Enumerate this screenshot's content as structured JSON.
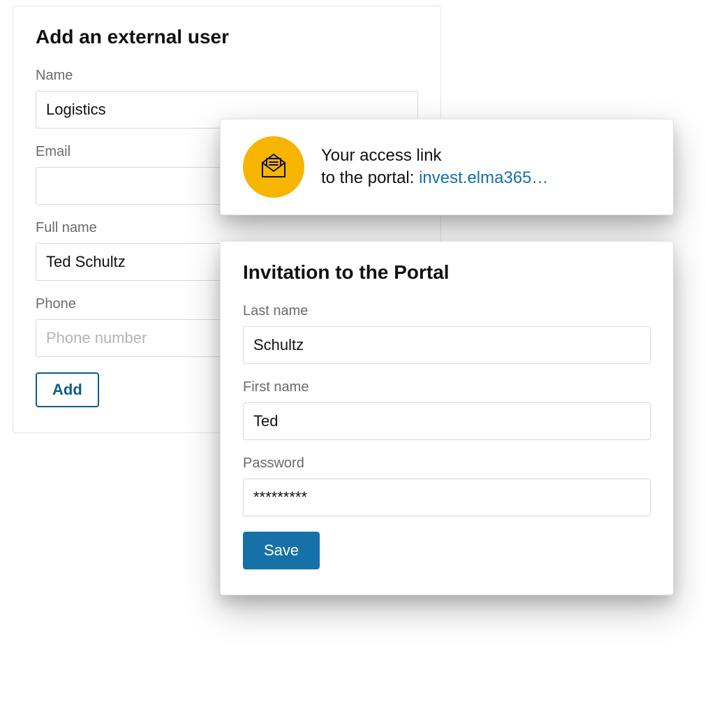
{
  "addUser": {
    "title": "Add an external user",
    "nameLabel": "Name",
    "nameValue": "Logistics",
    "emailLabel": "Email",
    "emailValue": "",
    "fullNameLabel": "Full name",
    "fullNameValue": "Ted Schultz",
    "phoneLabel": "Phone",
    "phonePlaceholder": "Phone number",
    "phoneValue": "",
    "addButton": "Add"
  },
  "accessLink": {
    "textLine1": "Your access link",
    "textLine2Prefix": "to the portal: ",
    "linkText": "invest.elma365…"
  },
  "invitation": {
    "title": "Invitation to the Portal",
    "lastNameLabel": "Last name",
    "lastNameValue": "Schultz",
    "firstNameLabel": "First name",
    "firstNameValue": "Ted",
    "passwordLabel": "Password",
    "passwordValue": "*********",
    "saveButton": "Save"
  }
}
